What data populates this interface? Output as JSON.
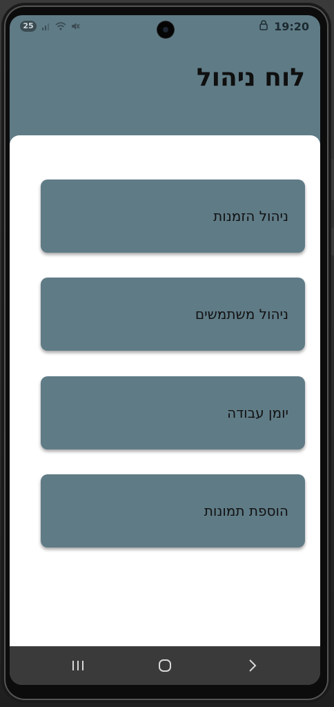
{
  "status_bar": {
    "badge": "25",
    "time": "19:20",
    "icons": [
      "signal-icon",
      "wifi-icon",
      "mute-icon",
      "lock-icon"
    ]
  },
  "header": {
    "title": "לוח ניהול"
  },
  "menu": {
    "items": [
      {
        "label": "ניהול הזמנות"
      },
      {
        "label": "ניהול משתמשים"
      },
      {
        "label": "יומן עבודה"
      },
      {
        "label": "הוספת תמונות"
      }
    ]
  },
  "nav_bar": {
    "items": [
      "recents-icon",
      "home-icon",
      "back-icon"
    ]
  },
  "colors": {
    "primary": "#5f7b86",
    "surface": "#ffffff",
    "nav": "#3a3a3a",
    "text": "#111111"
  }
}
